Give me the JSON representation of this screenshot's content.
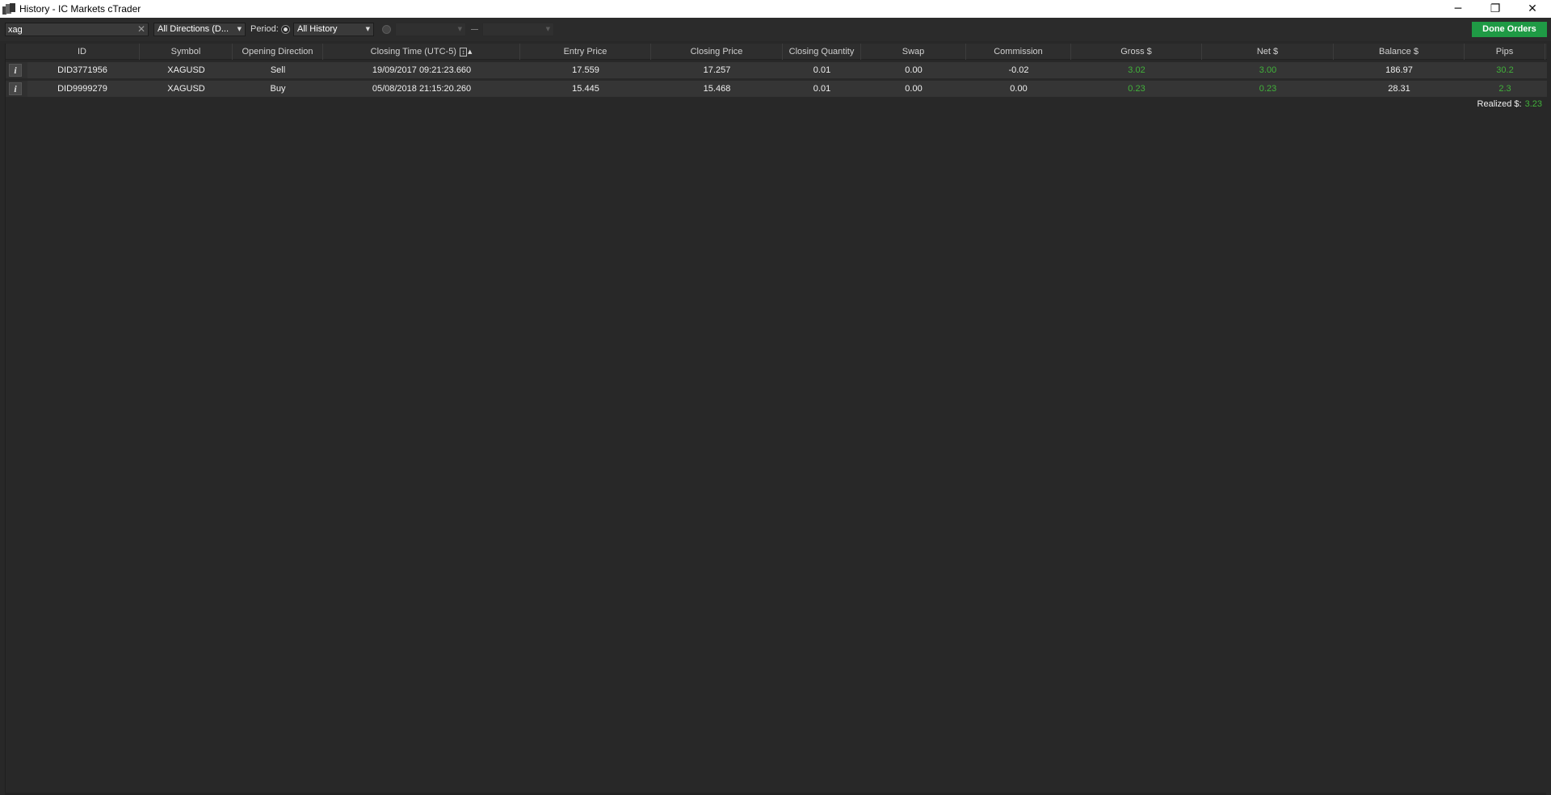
{
  "window": {
    "title": "History - IC Markets cTrader",
    "controls": {
      "minimize": "─",
      "restore": "❐",
      "close": "✕"
    }
  },
  "toolbar": {
    "search_value": "xag",
    "search_clear": "✕",
    "direction_filter": "All Directions (D...",
    "period_label": "Period:",
    "period_value": "All History",
    "date_from": "",
    "date_to": "",
    "done_orders_label": "Done Orders"
  },
  "table": {
    "columns": [
      "ID",
      "Symbol",
      "Opening Direction",
      "Closing Time (UTC-5)",
      "Entry Price",
      "Closing Price",
      "Closing Quantity",
      "Swap",
      "Commission",
      "Gross $",
      "Net $",
      "Balance $",
      "Pips"
    ],
    "sort_box": "↕",
    "sort_arrow": "▲",
    "info_label": "i",
    "rows": [
      {
        "id": "DID3771956",
        "symbol": "XAGUSD",
        "direction": "Sell",
        "closing_time": "19/09/2017 09:21:23.660",
        "entry_price": "17.559",
        "closing_price": "17.257",
        "closing_quantity": "0.01",
        "swap": "0.00",
        "commission": "-0.02",
        "gross": "3.02",
        "net": "3.00",
        "balance": "186.97",
        "pips": "30.2"
      },
      {
        "id": "DID9999279",
        "symbol": "XAGUSD",
        "direction": "Buy",
        "closing_time": "05/08/2018 21:15:20.260",
        "entry_price": "15.445",
        "closing_price": "15.468",
        "closing_quantity": "0.01",
        "swap": "0.00",
        "commission": "0.00",
        "gross": "0.23",
        "net": "0.23",
        "balance": "28.31",
        "pips": "2.3"
      }
    ]
  },
  "summary": {
    "realized_label": "Realized $:",
    "realized_value": "3.23"
  },
  "colors": {
    "positive": "#41b13a",
    "accent_button": "#1f9a45",
    "background": "#282828"
  }
}
